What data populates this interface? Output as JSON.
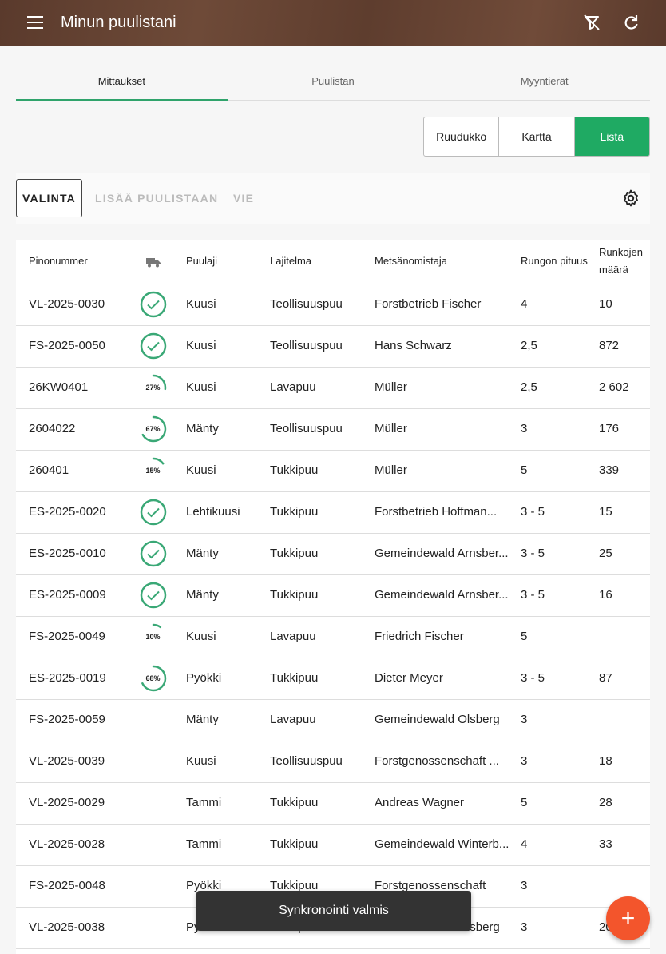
{
  "appbar": {
    "title": "Minun puulistani",
    "menu_icon": "menu-icon",
    "filter_icon": "filter-off-icon",
    "refresh_icon": "refresh-icon"
  },
  "tabs": [
    {
      "label": "Mittaukset",
      "active": true
    },
    {
      "label": "Puulistan",
      "active": false
    },
    {
      "label": "Myyntierät",
      "active": false
    }
  ],
  "view_toggle": [
    {
      "label": "Ruudukko"
    },
    {
      "label": "Kartta"
    },
    {
      "label": "Lista",
      "selected": true
    }
  ],
  "actions": {
    "valinta": "VALINTA",
    "lisaa": "LISÄÄ PUULISTAAN",
    "vie": "VIE",
    "settings_icon": "gear-icon"
  },
  "table": {
    "headers": {
      "pinonumero": "Pinonummer",
      "status_icon": "truck-icon",
      "puulaji": "Puulaji",
      "lajitelma": "Lajitelma",
      "metsanomistaja": "Metsänomistaja",
      "rungon_pituus": "Rungon pituus",
      "runkojen_maara": "Runkojen määrä"
    },
    "rows": [
      {
        "id": "VL-2025-0030",
        "status": "done",
        "progress": 1.0,
        "puulaji": "Kuusi",
        "lajitelma": "Teollisuuspuu",
        "omistaja": "Forstbetrieb Fischer",
        "pituus": "4",
        "maara": "10"
      },
      {
        "id": "FS-2025-0050",
        "status": "done",
        "progress": 1.0,
        "puulaji": "Kuusi",
        "lajitelma": "Teollisuuspuu",
        "omistaja": "Hans Schwarz",
        "pituus": "2,5",
        "maara": "872"
      },
      {
        "id": "26KW0401",
        "status": "progress",
        "progress": 0.27,
        "progress_label": "27%",
        "puulaji": "Kuusi",
        "lajitelma": "Lavapuu",
        "omistaja": "Müller",
        "pituus": "2,5",
        "maara": "2 602"
      },
      {
        "id": "2604022",
        "status": "progress",
        "progress": 0.67,
        "progress_label": "67%",
        "puulaji": "Mänty",
        "lajitelma": "Teollisuuspuu",
        "omistaja": "Müller",
        "pituus": "3",
        "maara": "176"
      },
      {
        "id": "260401",
        "status": "progress",
        "progress": 0.15,
        "progress_label": "15%",
        "puulaji": "Kuusi",
        "lajitelma": "Tukkipuu",
        "omistaja": "Müller",
        "pituus": "5",
        "maara": "339"
      },
      {
        "id": "ES-2025-0020",
        "status": "done",
        "progress": 1.0,
        "puulaji": "Lehtikuusi",
        "lajitelma": "Tukkipuu",
        "omistaja": "Forstbetrieb Hoffman...",
        "pituus": "3 - 5",
        "maara": "15"
      },
      {
        "id": "ES-2025-0010",
        "status": "done",
        "progress": 1.0,
        "puulaji": "Mänty",
        "lajitelma": "Tukkipuu",
        "omistaja": "Gemeindewald Arnsber...",
        "pituus": "3 - 5",
        "maara": "25"
      },
      {
        "id": "ES-2025-0009",
        "status": "done",
        "progress": 1.0,
        "puulaji": "Mänty",
        "lajitelma": "Tukkipuu",
        "omistaja": "Gemeindewald Arnsber...",
        "pituus": "3 - 5",
        "maara": "16"
      },
      {
        "id": "FS-2025-0049",
        "status": "progress",
        "progress": 0.1,
        "progress_label": "10%",
        "puulaji": "Kuusi",
        "lajitelma": "Lavapuu",
        "omistaja": "Friedrich Fischer",
        "pituus": "5",
        "maara": ""
      },
      {
        "id": "ES-2025-0019",
        "status": "progress",
        "progress": 0.68,
        "progress_label": "68%",
        "puulaji": "Pyökki",
        "lajitelma": "Tukkipuu",
        "omistaja": "Dieter Meyer",
        "pituus": "3 - 5",
        "maara": "87"
      },
      {
        "id": "FS-2025-0059",
        "status": "none",
        "puulaji": "Mänty",
        "lajitelma": "Lavapuu",
        "omistaja": "Gemeindewald Olsberg",
        "pituus": "3",
        "maara": ""
      },
      {
        "id": "VL-2025-0039",
        "status": "none",
        "puulaji": "Kuusi",
        "lajitelma": "Teollisuuspuu",
        "omistaja": "Forstgenossenschaft ...",
        "pituus": "3",
        "maara": "18"
      },
      {
        "id": "VL-2025-0029",
        "status": "none",
        "puulaji": "Tammi",
        "lajitelma": "Tukkipuu",
        "omistaja": "Andreas Wagner",
        "pituus": "5",
        "maara": "28"
      },
      {
        "id": "VL-2025-0028",
        "status": "none",
        "puulaji": "Tammi",
        "lajitelma": "Tukkipuu",
        "omistaja": "Gemeindewald Winterb...",
        "pituus": "4",
        "maara": "33"
      },
      {
        "id": "FS-2025-0048",
        "status": "none",
        "puulaji": "Pyökki",
        "lajitelma": "Tukkipuu",
        "omistaja": "Forstgenossenschaft",
        "pituus": "3",
        "maara": ""
      },
      {
        "id": "VL-2025-0038",
        "status": "none",
        "puulaji": "Pyökki",
        "lajitelma": "Tukkipuu",
        "omistaja": "Gemeindewald Olsberg",
        "pituus": "3",
        "maara": "20"
      }
    ]
  },
  "toast": {
    "message": "Synkronointi valmis"
  },
  "fab": {
    "label": "+",
    "icon": "plus-icon"
  },
  "colors": {
    "accent": "#2fa36b",
    "selected_toggle": "#1faa63",
    "fab": "#f3552c",
    "status_ring": "#3aa876"
  }
}
